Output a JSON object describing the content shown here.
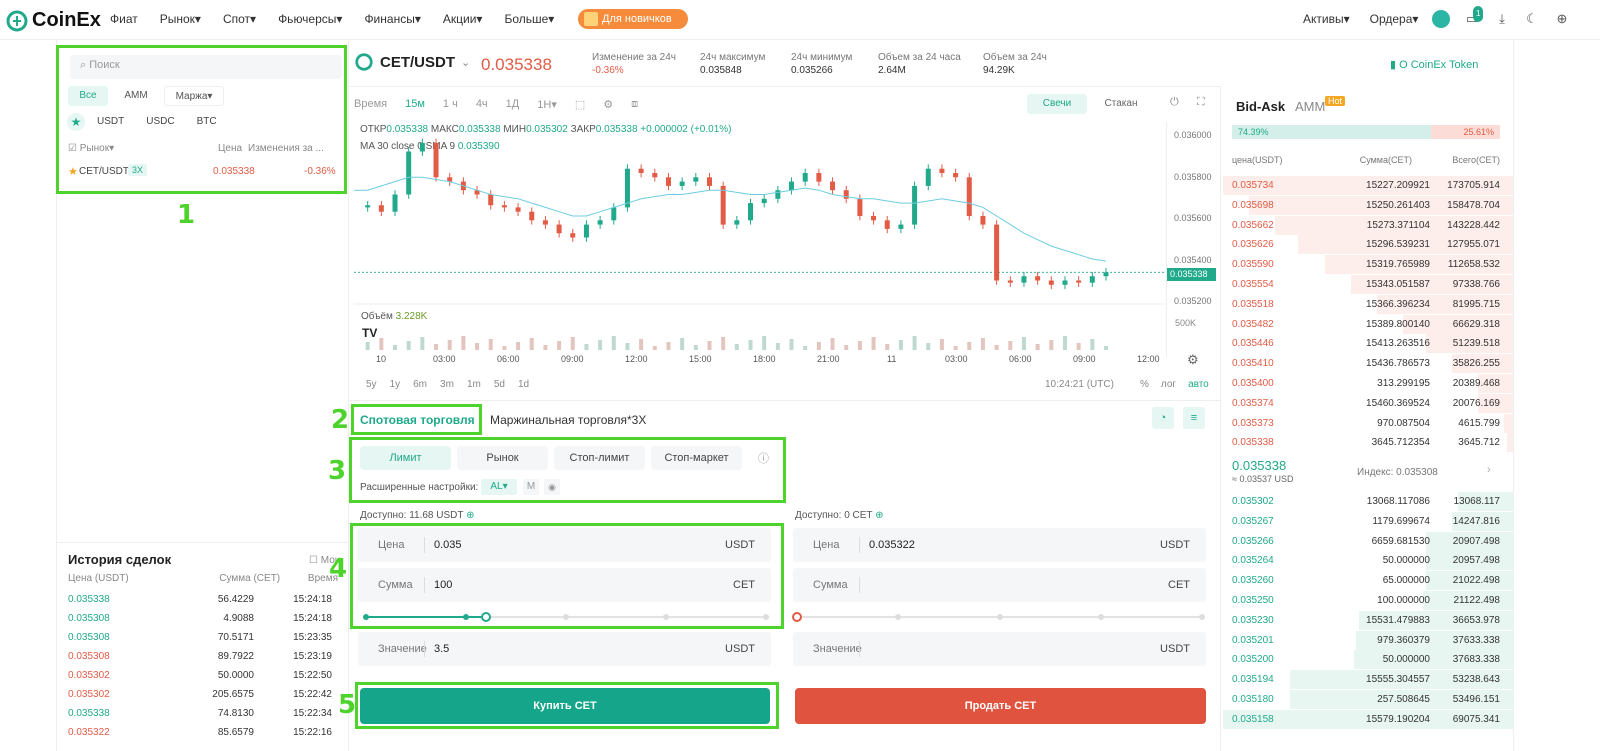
{
  "nav": {
    "logo": "CoinEx",
    "menu": [
      "Фиат",
      "Рынок",
      "Спот",
      "Фьючерсы",
      "Финансы",
      "Акции",
      "Больше"
    ],
    "promo": "Для новичков",
    "assets": "Активы",
    "orders": "Ордера",
    "msg_badge": "1"
  },
  "market_panel": {
    "search_placeholder": "Поиск",
    "tabs": [
      "Все",
      "AMM",
      "Маржа"
    ],
    "quotes": [
      "USDT",
      "USDC",
      "BTC"
    ],
    "col_market": "Рынок",
    "col_price": "Цена",
    "col_change": "Изменения за ...",
    "row_pair": "CET/USDT",
    "row_leverage": "3X",
    "row_price": "0.035338",
    "row_change": "-0.36%"
  },
  "ticker": {
    "pair": "CET/USDT",
    "price": "0.035338",
    "stats": [
      {
        "label": "Изменение за 24ч",
        "value": "-0.36%"
      },
      {
        "label": "24ч максимум",
        "value": "0.035848"
      },
      {
        "label": "24ч минимум",
        "value": "0.035266"
      },
      {
        "label": "Объем за 24 часа",
        "value": "2.64M"
      },
      {
        "label": "Объем за 24ч",
        "value": "94.29K"
      }
    ],
    "token_link": "О CoinEx Token"
  },
  "chart_toolbar": {
    "items": [
      "Время",
      "15м",
      "1 ч",
      "4ч",
      "1Д",
      "1Н"
    ],
    "candles": "Свечи",
    "depth": "Стакан"
  },
  "chart": {
    "ohlc_label": "ОТКР",
    "ohlc_open": "0.035338",
    "ohlc_high_label": "МАКС",
    "ohlc_high": "0.035338",
    "ohlc_low_label": "МИН",
    "ohlc_low": "0.035302",
    "ohlc_close_label": "ЗАКР",
    "ohlc_close": "0.035338",
    "ohlc_change": "+0.000002 (+0.01%)",
    "ma_label": "MA 30 close 0 SMA 9",
    "ma_value": "0.035390",
    "price_ticks": [
      "0.036000",
      "0.035800",
      "0.035600",
      "0.035400",
      "0.035200"
    ],
    "last_price": "0.035338",
    "volume_label": "Объём",
    "volume_value": "3.228K",
    "volume_tick": "500K",
    "time_ticks": [
      "10",
      "03:00",
      "06:00",
      "09:00",
      "12:00",
      "15:00",
      "18:00",
      "21:00",
      "11",
      "03:00",
      "06:00",
      "09:00",
      "12:00"
    ],
    "ranges": [
      "5y",
      "1y",
      "6m",
      "3m",
      "1m",
      "5d",
      "1d"
    ],
    "clock": "10:24:21 (UTC)",
    "scale_opts": [
      "%",
      "лог",
      "авто"
    ]
  },
  "chart_data": {
    "type": "line",
    "series": [
      {
        "values": [
          35640,
          35650,
          35620,
          35700,
          35900,
          35940,
          35780,
          35760,
          35720,
          35700,
          35650,
          35640,
          35620,
          35580,
          35560,
          35520,
          35500,
          35560,
          35580,
          35640,
          35820,
          35800,
          35780,
          35740,
          35760,
          35780,
          35740,
          35560,
          35580,
          35660,
          35680,
          35720,
          35760,
          35800,
          35760,
          35720,
          35680,
          35600,
          35580,
          35540,
          35560,
          35740,
          35820,
          35800,
          35780,
          35600,
          35560,
          35300,
          35290,
          35320,
          35300,
          35280,
          35300,
          35290,
          35320,
          35338
        ]
      },
      {
        "values": [
          35720,
          35720,
          35740,
          35760,
          35780,
          35780,
          35770,
          35760,
          35740,
          35720,
          35700,
          35690,
          35680,
          35660,
          35640,
          35620,
          35600,
          35600,
          35620,
          35640,
          35660,
          35680,
          35690,
          35700,
          35700,
          35710,
          35720,
          35720,
          35710,
          35700,
          35700,
          35710,
          35720,
          35730,
          35720,
          35700,
          35690,
          35680,
          35680,
          35670,
          35660,
          35660,
          35670,
          35680,
          35670,
          35660,
          35640,
          35600,
          35560,
          35520,
          35490,
          35460,
          35440,
          35420,
          35400,
          35390
        ]
      }
    ],
    "ylim": [
      35200,
      36000
    ]
  },
  "trade": {
    "tab_spot": "Спотовая торговля",
    "tab_margin": "Маржинальная торговля*3X",
    "order_types": [
      "Лимит",
      "Рынок",
      "Стоп-лимит",
      "Стоп-маркет"
    ],
    "adv_label": "Расширенные настройки:",
    "adv_al": "AL",
    "adv_m": "M",
    "buy": {
      "avail": "Доступно: 11.68 USDT",
      "price_label": "Цена",
      "price": "0.035",
      "price_unit": "USDT",
      "amount_label": "Сумма",
      "amount": "100",
      "amount_unit": "CET",
      "value_label": "Значение",
      "value": "3.5",
      "value_unit": "USDT",
      "button": "Купить CET",
      "slider_pct": 0.3
    },
    "sell": {
      "avail": "Доступно: 0 CET",
      "price_label": "Цена",
      "price": "0.035322",
      "price_unit": "USDT",
      "amount_label": "Сумма",
      "amount": "",
      "amount_unit": "CET",
      "value_label": "Значение",
      "value": "",
      "value_unit": "USDT",
      "button": "Продать CET",
      "slider_pct": 0
    }
  },
  "history": {
    "title": "История сделок",
    "mine": "Мои",
    "cols": [
      "Цена (USDT)",
      "Сумма (CET)",
      "Время"
    ],
    "rows": [
      {
        "p": "0.035338",
        "a": "56.4229",
        "t": "15:24:18",
        "side": "buy"
      },
      {
        "p": "0.035308",
        "a": "4.9088",
        "t": "15:24:18",
        "side": "buy"
      },
      {
        "p": "0.035308",
        "a": "70.5171",
        "t": "15:23:35",
        "side": "buy"
      },
      {
        "p": "0.035308",
        "a": "89.7922",
        "t": "15:23:19",
        "side": "sell"
      },
      {
        "p": "0.035302",
        "a": "50.0000",
        "t": "15:22:50",
        "side": "sell"
      },
      {
        "p": "0.035302",
        "a": "205.6575",
        "t": "15:22:42",
        "side": "sell"
      },
      {
        "p": "0.035338",
        "a": "74.8130",
        "t": "15:22:34",
        "side": "buy"
      },
      {
        "p": "0.035322",
        "a": "85.6579",
        "t": "15:22:16",
        "side": "sell"
      }
    ]
  },
  "orderbook": {
    "tab_bidask": "Bid-Ask",
    "tab_amm": "AMM",
    "hot": "Hot",
    "buy_pct": "74.39%",
    "sell_pct": "25.61%",
    "buy_ratio": 0.7439,
    "cols": [
      "цена(USDT)",
      "Сумма(CET)",
      "Всего(CET)"
    ],
    "asks": [
      {
        "p": "0.035734",
        "a": "15227.209921",
        "t": "173705.914",
        "d": 1.0
      },
      {
        "p": "0.035698",
        "a": "15250.261403",
        "t": "158478.704",
        "d": 0.91
      },
      {
        "p": "0.035662",
        "a": "15273.371104",
        "t": "143228.442",
        "d": 0.82
      },
      {
        "p": "0.035626",
        "a": "15296.539231",
        "t": "127955.071",
        "d": 0.74
      },
      {
        "p": "0.035590",
        "a": "15319.765989",
        "t": "112658.532",
        "d": 0.65
      },
      {
        "p": "0.035554",
        "a": "15343.051587",
        "t": "97338.766",
        "d": 0.56
      },
      {
        "p": "0.035518",
        "a": "15366.396234",
        "t": "81995.715",
        "d": 0.47
      },
      {
        "p": "0.035482",
        "a": "15389.800140",
        "t": "66629.318",
        "d": 0.38
      },
      {
        "p": "0.035446",
        "a": "15413.263516",
        "t": "51239.518",
        "d": 0.3
      },
      {
        "p": "0.035410",
        "a": "15436.786573",
        "t": "35826.255",
        "d": 0.21
      },
      {
        "p": "0.035400",
        "a": "313.299195",
        "t": "20389.468",
        "d": 0.12
      },
      {
        "p": "0.035374",
        "a": "15460.369524",
        "t": "20076.169",
        "d": 0.12
      },
      {
        "p": "0.035373",
        "a": "970.087504",
        "t": "4615.799",
        "d": 0.03
      },
      {
        "p": "0.035338",
        "a": "3645.712354",
        "t": "3645.712",
        "d": 0.02
      }
    ],
    "mid_price": "0.035338",
    "mid_usd": "≈ 0.03537 USD",
    "index": "Индекс: 0.035308",
    "bids": [
      {
        "p": "0.035302",
        "a": "13068.117086",
        "t": "13068.117",
        "d": 0.19
      },
      {
        "p": "0.035267",
        "a": "1179.699674",
        "t": "14247.816",
        "d": 0.21
      },
      {
        "p": "0.035266",
        "a": "6659.681530",
        "t": "20907.498",
        "d": 0.3
      },
      {
        "p": "0.035264",
        "a": "50.000000",
        "t": "20957.498",
        "d": 0.3
      },
      {
        "p": "0.035260",
        "a": "65.000000",
        "t": "21022.498",
        "d": 0.3
      },
      {
        "p": "0.035250",
        "a": "100.000000",
        "t": "21122.498",
        "d": 0.31
      },
      {
        "p": "0.035230",
        "a": "15531.479883",
        "t": "36653.978",
        "d": 0.53
      },
      {
        "p": "0.035201",
        "a": "979.360379",
        "t": "37633.338",
        "d": 0.54
      },
      {
        "p": "0.035200",
        "a": "50.000000",
        "t": "37683.338",
        "d": 0.55
      },
      {
        "p": "0.035194",
        "a": "15555.304557",
        "t": "53238.643",
        "d": 0.77
      },
      {
        "p": "0.035180",
        "a": "257.508645",
        "t": "53496.151",
        "d": 0.77
      },
      {
        "p": "0.035158",
        "a": "15579.190204",
        "t": "69075.341",
        "d": 1.0
      }
    ]
  },
  "annotations": [
    "1",
    "2",
    "3",
    "4",
    "5"
  ]
}
